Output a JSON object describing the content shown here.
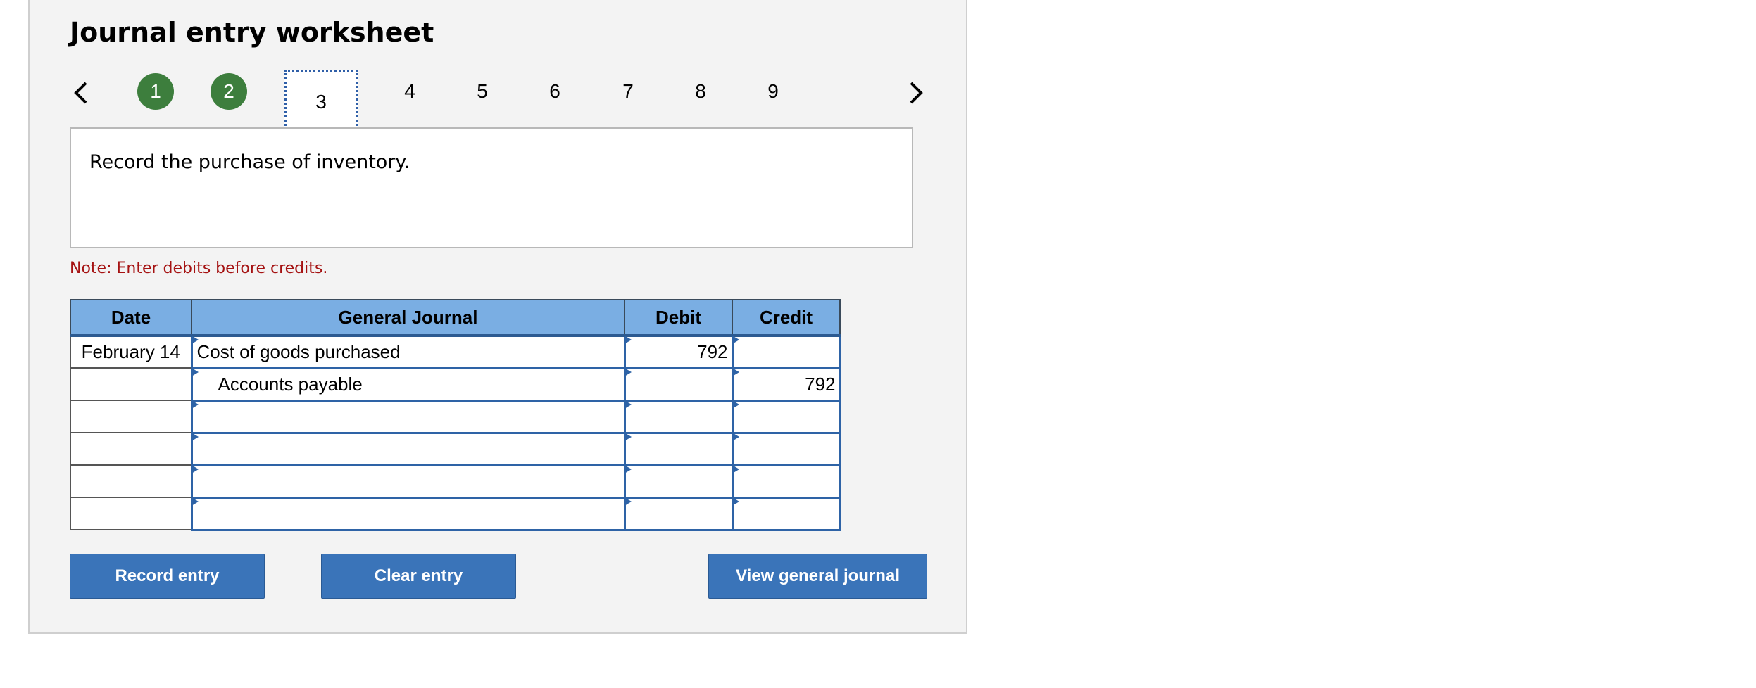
{
  "title": "Journal entry worksheet",
  "nav": {
    "steps": [
      "1",
      "2",
      "3",
      "4",
      "5",
      "6",
      "7",
      "8",
      "9"
    ],
    "completed_color": "#3d7e3d"
  },
  "prompt": "Record the purchase of inventory.",
  "note": "Note: Enter debits before credits.",
  "table": {
    "headers": {
      "date": "Date",
      "account": "General Journal",
      "debit": "Debit",
      "credit": "Credit"
    },
    "rows": [
      {
        "date": "February 14",
        "account": "Cost of goods purchased",
        "debit": "792",
        "credit": ""
      },
      {
        "date": "",
        "account": "Accounts payable",
        "debit": "",
        "credit": "792"
      },
      {
        "date": "",
        "account": "",
        "debit": "",
        "credit": ""
      },
      {
        "date": "",
        "account": "",
        "debit": "",
        "credit": ""
      },
      {
        "date": "",
        "account": "",
        "debit": "",
        "credit": ""
      },
      {
        "date": "",
        "account": "",
        "debit": "",
        "credit": ""
      }
    ]
  },
  "buttons": {
    "record": "Record entry",
    "clear": "Clear entry",
    "view": "View general journal"
  },
  "colors": {
    "header_bg": "#7aaee3",
    "button_bg": "#3a74b9",
    "note": "#a51212"
  }
}
